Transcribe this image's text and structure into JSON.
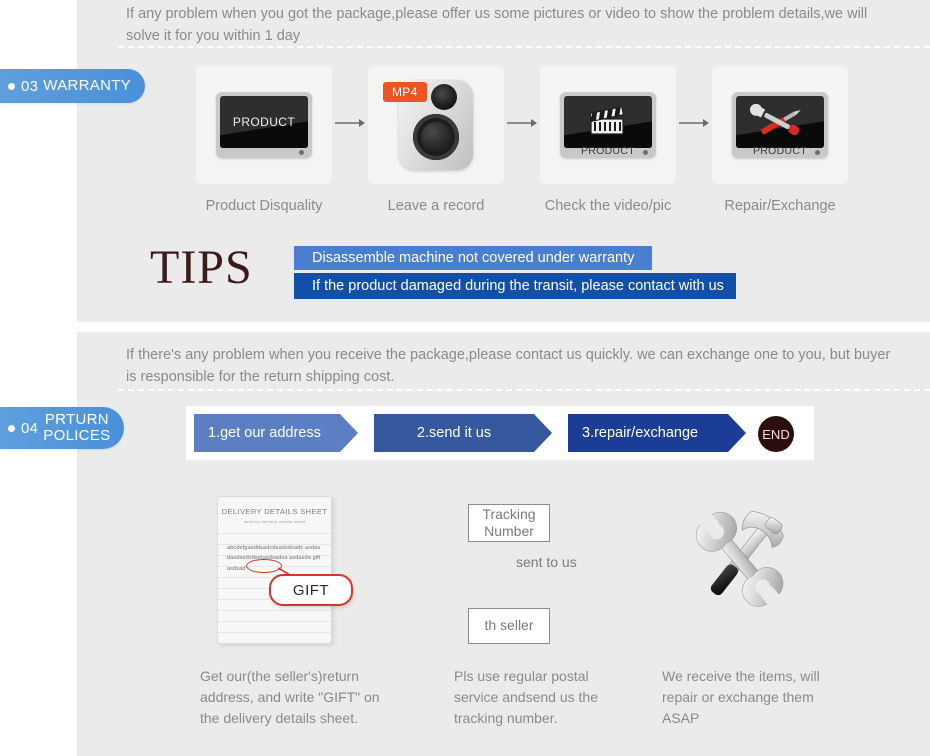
{
  "sections": {
    "warranty": {
      "badge": {
        "number": "03",
        "title": "WARRANTY"
      },
      "intro": "If any problem when you got the package,please offer us some pictures or video to show the problem details,we will solve  it for you within 1 day",
      "steps": [
        {
          "label": "Product Disquality",
          "icon": "monitor-icon",
          "screen_text": "PRODUCT"
        },
        {
          "label": "Leave a record",
          "icon": "camera-icon",
          "tag": "MP4"
        },
        {
          "label": "Check the video/pic",
          "icon": "clapperboard-monitor-icon",
          "screen_text": "PRODUCT"
        },
        {
          "label": "Repair/Exchange",
          "icon": "tools-monitor-icon",
          "screen_text": "PRODUCT"
        }
      ],
      "arrow_glyph": "→",
      "tips": {
        "word": "TIPS",
        "bar1": "Disassemble machine not covered under warranty",
        "bar2": "If the product damaged during the transit, please contact with us"
      }
    },
    "return": {
      "badge": {
        "number": "04",
        "title_line1": "PRTURN",
        "title_line2": "POLICES"
      },
      "intro": "If  there's any problem when you receive the package,please contact us quickly. we can exchange one to you, but buyer is responsible for the return shipping cost.",
      "flow": {
        "steps": [
          "1.get our address",
          "2.send it us",
          "3.repair/exchange"
        ],
        "end_label": "END"
      },
      "columns": [
        {
          "icon": "delivery-details-sheet-icon",
          "sheet_title": "DELIVERY DETAILS SHEET",
          "sheet_subtitle": "delivery       delivery details sheet",
          "sheet_body": "abcdefgasddsadcdsadsdsads asdasdasdasdsdsetasdsadsa asdasda gift asdsad",
          "bubble_label": "GIFT",
          "caption": "Get our(the seller's)return address, and write \"GIFT\" on the delivery details sheet."
        },
        {
          "icon": "tracking-flow-icon",
          "box_top": "Tracking Number",
          "arrow_label": "sent to us",
          "box_bottom": "th seller",
          "caption": "Pls use regular postal service andsend us the  tracking number."
        },
        {
          "icon": "hammer-wrench-icon",
          "caption": "We receive the items, will repair or exchange  them ASAP"
        }
      ]
    }
  },
  "colors": {
    "band_bg": "#ebebeb",
    "badge_blue": "#4a90d9",
    "tip_bar_light": "#4a7fd0",
    "tip_bar_dark": "#1250a8",
    "chevron_1": "#5c7fc4",
    "chevron_2": "#35589f",
    "chevron_3": "#1b3d96",
    "end_circle": "#2b0d0d",
    "mp4_tag": "#ec5522",
    "tips_word": "#3a1a1a",
    "text_gray": "#8a8a8a"
  }
}
